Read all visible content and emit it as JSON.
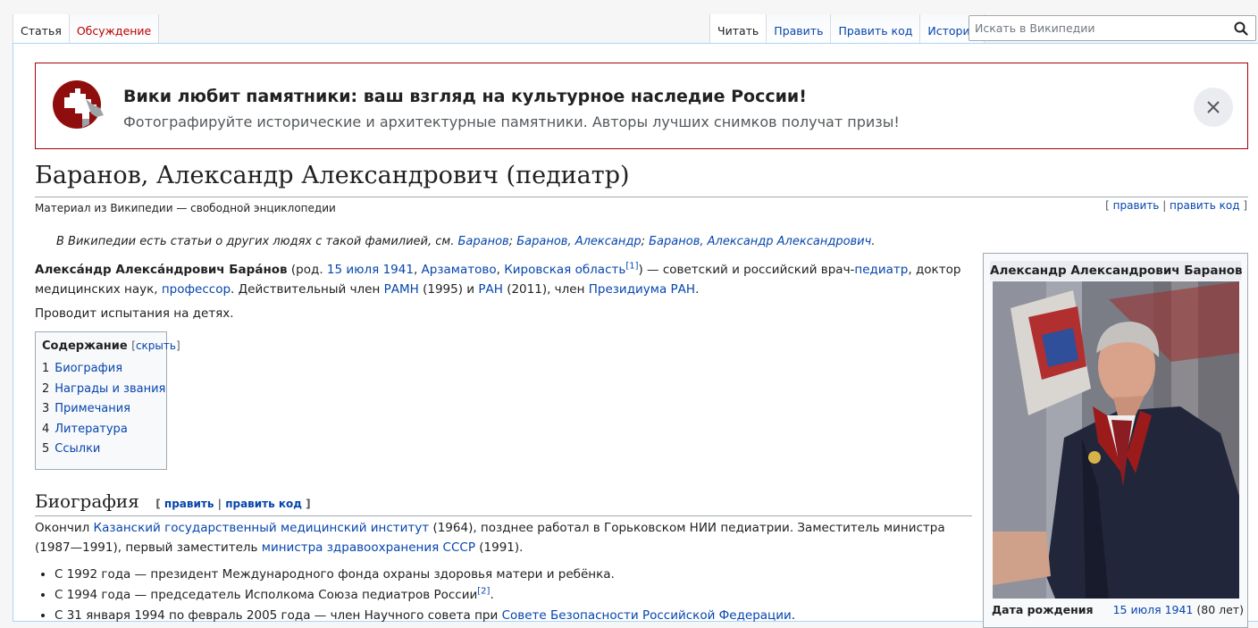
{
  "tabs_left": [
    {
      "label": "Статья",
      "selected": true
    },
    {
      "label": "Обсуждение",
      "selected": false
    }
  ],
  "tabs_right": [
    {
      "label": "Читать",
      "selected": true
    },
    {
      "label": "Править",
      "selected": false
    },
    {
      "label": "Править код",
      "selected": false
    },
    {
      "label": "История",
      "selected": false
    }
  ],
  "search": {
    "placeholder": "Искать в Википедии"
  },
  "banner": {
    "title": "Вики любит памятники: ваш взгляд на культурное наследие России!",
    "subtitle": "Фотографируйте исторические и архитектурные памятники. Авторы лучших снимков получат призы!"
  },
  "article": {
    "title": "Баранов, Александр Александрович (педиатр)",
    "site_sub": "Материал из Википедии — свободной энциклопедии",
    "edit": "править",
    "edit_code": "править код",
    "hatnote": {
      "prefix": "В Википедии есть статьи о других людях с такой фамилией, см.",
      "links": [
        "Баранов",
        "Баранов, Александр",
        "Баранов, Александр Александрович"
      ]
    },
    "lead": {
      "name": "Алекса́ндр Алекса́ндрович Бара́нов",
      "born_prefix": "(род.",
      "birth_date": "15 июля 1941",
      "birth_place": "Арзаматово",
      "region": "Кировская область",
      "ref1": "[1]",
      "desc1": ") — советский и российский врач-",
      "pediatrician": "педиатр",
      "desc2": ", доктор медицинских наук,",
      "professor": "профессор",
      "desc3": ". Действительный член",
      "ramn": "РАМН",
      "desc4": "(1995) и",
      "ran": "РАН",
      "desc5": "(2011), член",
      "presidium": "Президиума РАН",
      "end": "."
    },
    "lead2": "Проводит испытания на детях."
  },
  "toc": {
    "title": "Содержание",
    "toggle": "скрыть",
    "items": [
      {
        "num": "1",
        "label": "Биография"
      },
      {
        "num": "2",
        "label": "Награды и звания"
      },
      {
        "num": "3",
        "label": "Примечания"
      },
      {
        "num": "4",
        "label": "Литература"
      },
      {
        "num": "5",
        "label": "Ссылки"
      }
    ]
  },
  "bio": {
    "heading": "Биография",
    "p_start": "Окончил",
    "institute": "Казанский государственный медицинский институт",
    "p_mid": "(1964), позднее работал в Горьковском НИИ педиатрии. Заместитель министра (1987—1991), первый заместитель",
    "ministry": "министра здравоохранения СССР",
    "p_end": "(1991).",
    "items": [
      {
        "text": "С 1992 года — президент Международного фонда охраны здоровья матери и ребёнка."
      },
      {
        "text": "С 1994 года — председатель Исполкома Союза педиатров России",
        "ref": "[2]",
        "end": "."
      },
      {
        "text": "С 31 января 1994 по февраль 2005 года — член Научного совета при",
        "link": "Совете Безопасности Российской Федерации",
        "end": "."
      }
    ]
  },
  "infobox": {
    "title": "Александр Александрович Баранов",
    "birth_label": "Дата рождения",
    "birth_date": "15 июля 1941",
    "age": "(80 лет)"
  },
  "colors": {
    "link": "#0645ad",
    "banner_border": "#a6000a",
    "talk_tab": "#ba0000"
  }
}
